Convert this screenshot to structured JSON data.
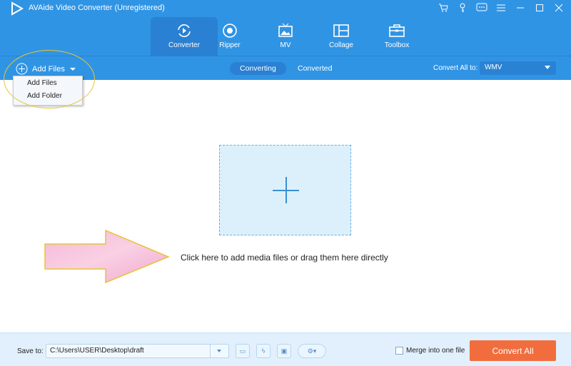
{
  "window": {
    "title": "AVAide Video Converter (Unregistered)",
    "icons": [
      "cart-icon",
      "key-icon",
      "feedback-icon",
      "menu-icon",
      "minimize-icon",
      "maximize-icon",
      "close-icon"
    ]
  },
  "nav": {
    "tabs": [
      {
        "label": "Converter",
        "icon": "converter-icon",
        "active": true
      },
      {
        "label": "Ripper",
        "icon": "ripper-icon"
      },
      {
        "label": "MV",
        "icon": "mv-icon"
      },
      {
        "label": "Collage",
        "icon": "collage-icon"
      },
      {
        "label": "Toolbox",
        "icon": "toolbox-icon"
      }
    ]
  },
  "toolbar": {
    "add_files": "Add Files",
    "segments": [
      "Converting",
      "Converted"
    ],
    "convert_all_label": "Convert All to:",
    "format": "WMV"
  },
  "dropdown": {
    "items": [
      "Add Files",
      "Add Folder"
    ]
  },
  "main": {
    "hint": "Click here to add media files or drag them here directly"
  },
  "footer": {
    "save_to_label": "Save to:",
    "path": "C:\\Users\\USER\\Desktop\\draft",
    "merge_label": "Merge into one file",
    "convert_button": "Convert All"
  },
  "colors": {
    "header": "#3094e4",
    "active_tab": "#2a80d2",
    "cta": "#f26d3d",
    "footer": "#e1f0fc",
    "highlight": "#e6c832"
  }
}
